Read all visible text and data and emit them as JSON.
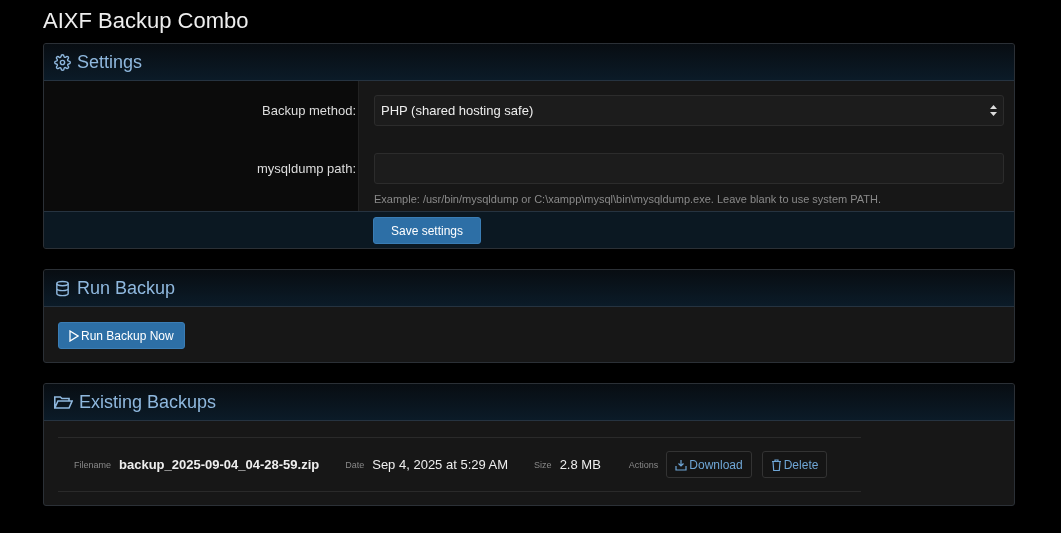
{
  "page_title": "AIXF Backup Combo",
  "settings": {
    "title": "Settings",
    "fields": [
      {
        "kind": "select",
        "label": "Backup method:",
        "value": "PHP (shared hosting safe)"
      },
      {
        "kind": "text",
        "label": "mysqldump path:",
        "help": "Example: /usr/bin/mysqldump or C:\\xampp\\mysql\\bin\\mysqldump.exe. Leave blank to use system PATH."
      }
    ],
    "save_button": "Save settings"
  },
  "run_backup": {
    "title": "Run Backup",
    "button": "Run Backup Now"
  },
  "existing_backups": {
    "title": "Existing Backups",
    "rows": [
      {
        "filename_label": "Filename",
        "filename": "backup_2025-09-04_04-28-59.zip",
        "date_label": "Date",
        "date": "Sep 4, 2025 at 5:29 AM",
        "size_label": "Size",
        "size": "2.8 MB",
        "actions_label": "Actions",
        "download": "Download",
        "delete": "Delete"
      }
    ]
  }
}
